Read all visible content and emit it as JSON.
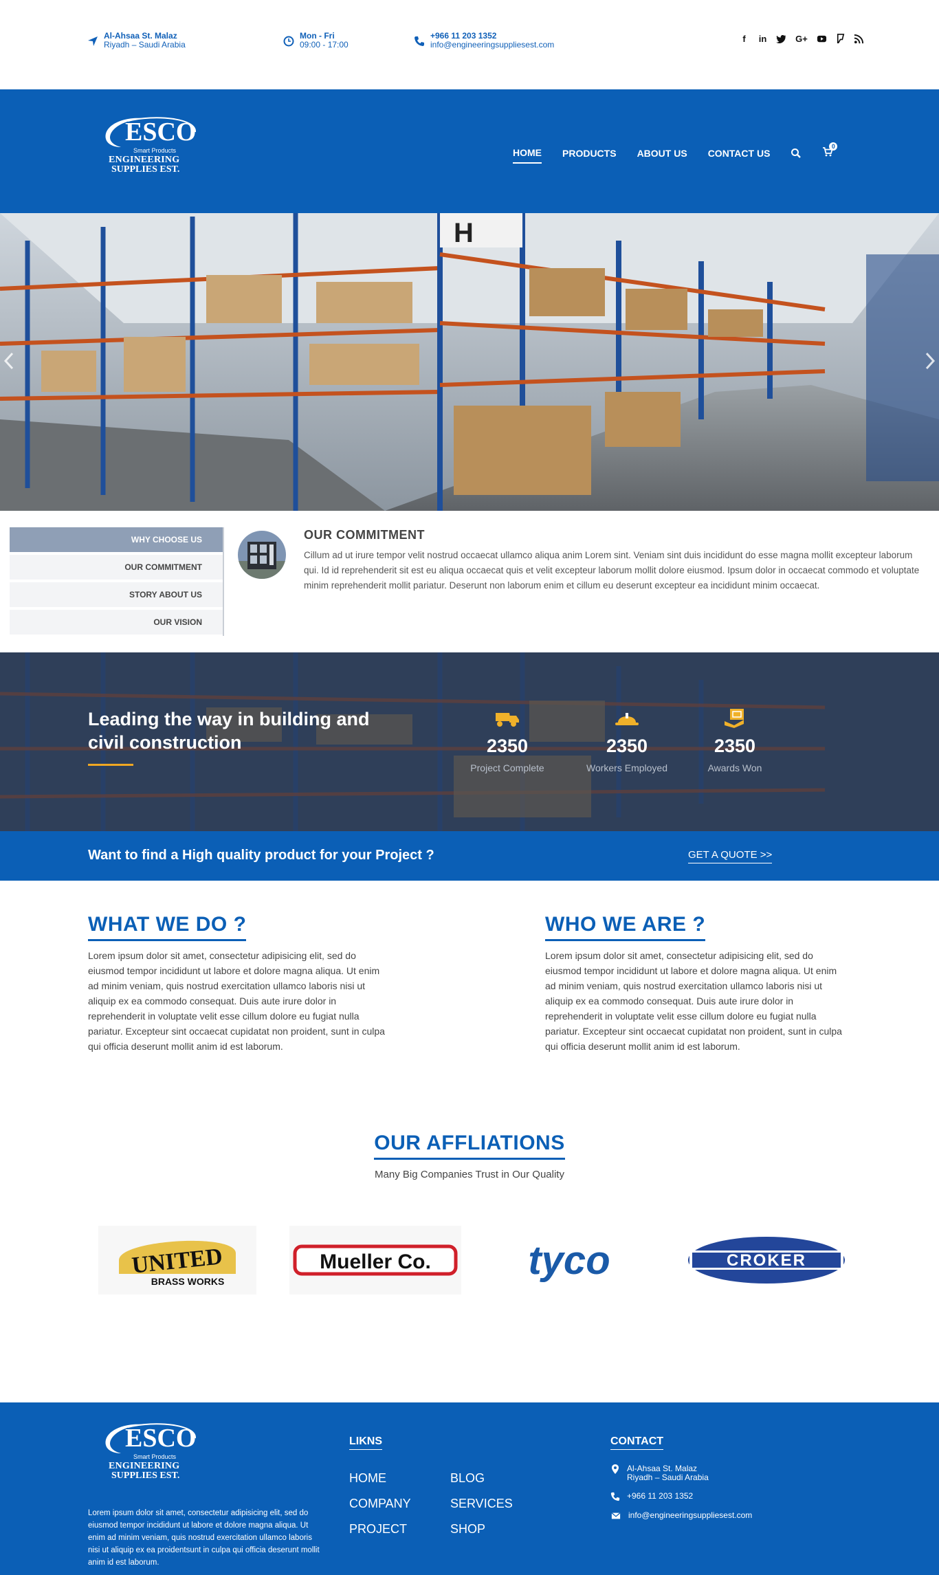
{
  "topbar": {
    "address_line1": "Al-Ahsaa St. Malaz",
    "address_line2": "Riyadh – Saudi Arabia",
    "hours_line1": "Mon - Fri",
    "hours_line2": "09:00 - 17:00",
    "phone": "+966 11 203 1352",
    "email": "info@engineeringsuppliesest.com",
    "social_icons": [
      "facebook-icon",
      "linkedin-icon",
      "twitter-icon",
      "google-plus-icon",
      "youtube-icon",
      "foursquare-icon",
      "rss-icon"
    ]
  },
  "logo": {
    "name": "ESCO",
    "tagline": "Smart Products",
    "line1": "ENGINEERING",
    "line2": "SUPPLIES EST."
  },
  "nav": {
    "items": [
      "HOME",
      "PRODUCTS",
      "ABOUT US",
      "CONTACT US"
    ],
    "active": "HOME",
    "cart_count": "0"
  },
  "tabs": {
    "items": [
      "WHY CHOOSE US",
      "OUR COMMITMENT",
      "STORY ABOUT US",
      "OUR VISION"
    ],
    "active": "WHY CHOOSE US"
  },
  "commitment": {
    "title": "OUR COMMITMENT",
    "text": "Cillum ad ut irure tempor velit nostrud occaecat ullamco aliqua anim Lorem sint. Veniam sint duis incididunt do esse magna mollit excepteur laborum qui. Id id reprehenderit sit est eu aliqua occaecat quis et velit excepteur laborum mollit dolore eiusmod. Ipsum dolor in occaecat commodo et voluptate minim reprehenderit mollit pariatur. Deserunt non laborum enim et cillum eu deserunt excepteur ea incididunt minim occaecat."
  },
  "stats": {
    "title": "Leading the way in building and civil construction",
    "items": [
      {
        "icon": "dump-truck-icon",
        "value": "2350",
        "label": "Project Complete"
      },
      {
        "icon": "hard-hat-icon",
        "value": "2350",
        "label": "Workers Employed"
      },
      {
        "icon": "award-certificate-icon",
        "value": "2350",
        "label": "Awards Won"
      }
    ]
  },
  "quote": {
    "text": "Want to find a High quality product for your Project ?",
    "button": "GET A QUOTE >>"
  },
  "what_we_do": {
    "title": "WHAT WE DO ?",
    "text": "Lorem ipsum dolor sit amet, consectetur adipisicing elit, sed do eiusmod tempor incididunt ut labore et dolore magna aliqua. Ut enim ad minim veniam, quis nostrud exercitation ullamco laboris nisi ut aliquip ex ea commodo consequat. Duis aute irure dolor in reprehenderit in voluptate velit esse cillum dolore eu fugiat nulla pariatur. Excepteur sint occaecat cupidatat non proident, sunt in culpa qui officia deserunt mollit anim id est laborum."
  },
  "who_we_are": {
    "title": "WHO WE ARE ?",
    "text": "Lorem ipsum dolor sit amet, consectetur adipisicing elit, sed do eiusmod tempor incididunt ut labore et dolore magna aliqua. Ut enim ad minim veniam, quis nostrud exercitation ullamco laboris nisi ut aliquip ex ea commodo consequat. Duis aute irure dolor in reprehenderit in voluptate velit esse cillum dolore eu fugiat nulla pariatur. Excepteur sint occaecat cupidatat non proident, sunt in culpa qui officia deserunt mollit anim id est laborum."
  },
  "affiliations": {
    "title": "OUR AFFLIATIONS",
    "subtitle": "Many Big Companies Trust in Our Quality",
    "logos": [
      {
        "name": "UNITED",
        "sub": "BRASS WORKS"
      },
      {
        "name": "Mueller Co."
      },
      {
        "name": "tyco"
      },
      {
        "name": "CROKER"
      }
    ]
  },
  "footer": {
    "about": "Lorem ipsum dolor sit amet, consectetur adipisicing elit, sed do eiusmod tempor incididunt ut labore et dolore magna aliqua. Ut enim ad minim veniam, quis nostrud exercitation ullamco laboris nisi ut aliquip ex ea proidentsunt in culpa qui officia deserunt mollit anim id est laborum.",
    "links_title": "LIKNS",
    "links_col1": [
      "HOME",
      "COMPANY",
      "PROJECT"
    ],
    "links_col2": [
      "BLOG",
      "SERVICES",
      "SHOP"
    ],
    "contact_title": "CONTACT",
    "address_line1": "Al-Ahsaa St. Malaz",
    "address_line2": "Riyadh – Saudi Arabia",
    "phone": "+966 11 203 1352",
    "email": "info@engineeringsuppliesest.com"
  },
  "colors": {
    "brand_blue": "#0b5fb6",
    "accent_orange": "#f0a722",
    "tab_active": "#8f9fb6"
  }
}
